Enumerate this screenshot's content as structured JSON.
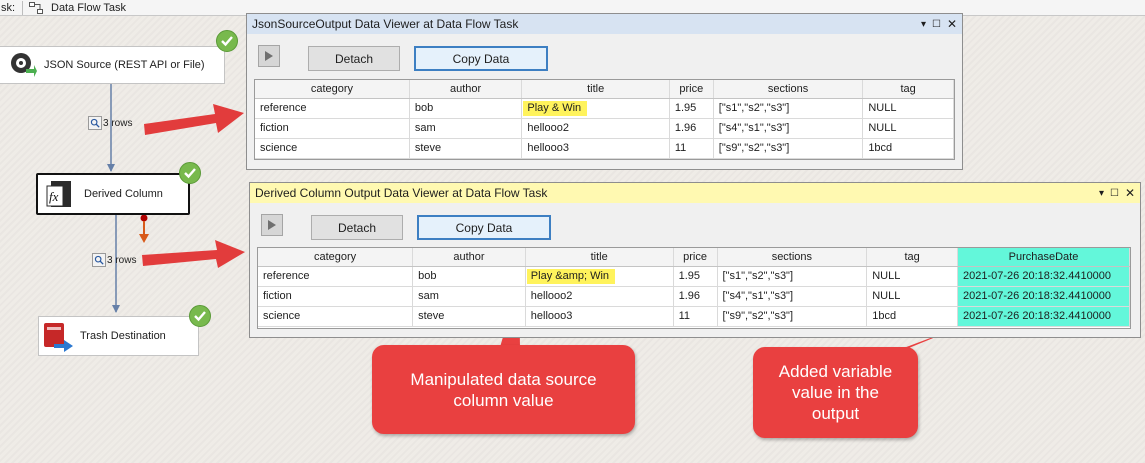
{
  "topbar": {
    "prefix": "sk:",
    "tab_title": "Data Flow Task"
  },
  "canvas": {
    "tasks": {
      "json_source": "JSON Source (REST API or File)",
      "derived_column": "Derived Column",
      "trash_destination": "Trash Destination"
    },
    "path_labels": {
      "first": "3 rows",
      "second": "3 rows"
    }
  },
  "viewer_one": {
    "title": "JsonSourceOutput Data Viewer at Data Flow Task",
    "detach_label": "Detach",
    "copy_label": "Copy Data",
    "columns": [
      "category",
      "author",
      "title",
      "price",
      "sections",
      "tag"
    ],
    "rows": [
      [
        "reference",
        "bob",
        "Play & Win",
        "1.95",
        "[\"s1\",\"s2\",\"s3\"]",
        "NULL"
      ],
      [
        "fiction",
        "sam",
        "hellooo2",
        "1.96",
        "[\"s4\",\"s1\",\"s3\"]",
        "NULL"
      ],
      [
        "science",
        "steve",
        "hellooo3",
        "11",
        "[\"s9\",\"s2\",\"s3\"]",
        "1bcd"
      ]
    ]
  },
  "viewer_two": {
    "title": "Derived Column Output Data Viewer at Data Flow Task",
    "detach_label": "Detach",
    "copy_label": "Copy Data",
    "columns": [
      "category",
      "author",
      "title",
      "price",
      "sections",
      "tag",
      "PurchaseDate"
    ],
    "rows": [
      [
        "reference",
        "bob",
        "Play &amp; Win",
        "1.95",
        "[\"s1\",\"s2\",\"s3\"]",
        "NULL",
        "2021-07-26 20:18:32.4410000"
      ],
      [
        "fiction",
        "sam",
        "hellooo2",
        "1.96",
        "[\"s4\",\"s1\",\"s3\"]",
        "NULL",
        "2021-07-26 20:18:32.4410000"
      ],
      [
        "science",
        "steve",
        "hellooo3",
        "11",
        "[\"s9\",\"s2\",\"s3\"]",
        "1bcd",
        "2021-07-26 20:18:32.4410000"
      ]
    ]
  },
  "callouts": {
    "manipulated": "Manipulated data source column value",
    "added": "Added variable value in the output"
  },
  "colors": {
    "highlight_yellow": "#fff35c",
    "highlight_teal": "#63f7da",
    "annotation_red": "#e94040",
    "success_green": "#78b94d",
    "viewer_two_titlebar": "#fff9b1"
  },
  "icons": {
    "tab": "data-flow-icon",
    "json_source": "json-source-icon",
    "derived_column": "fx-icon",
    "trash_destination": "trash-destination-icon",
    "status": "checkmark-icon",
    "path_viewer": "magnifier-icon",
    "window_controls": [
      "dropdown-icon",
      "maximize-icon",
      "close-icon"
    ]
  }
}
